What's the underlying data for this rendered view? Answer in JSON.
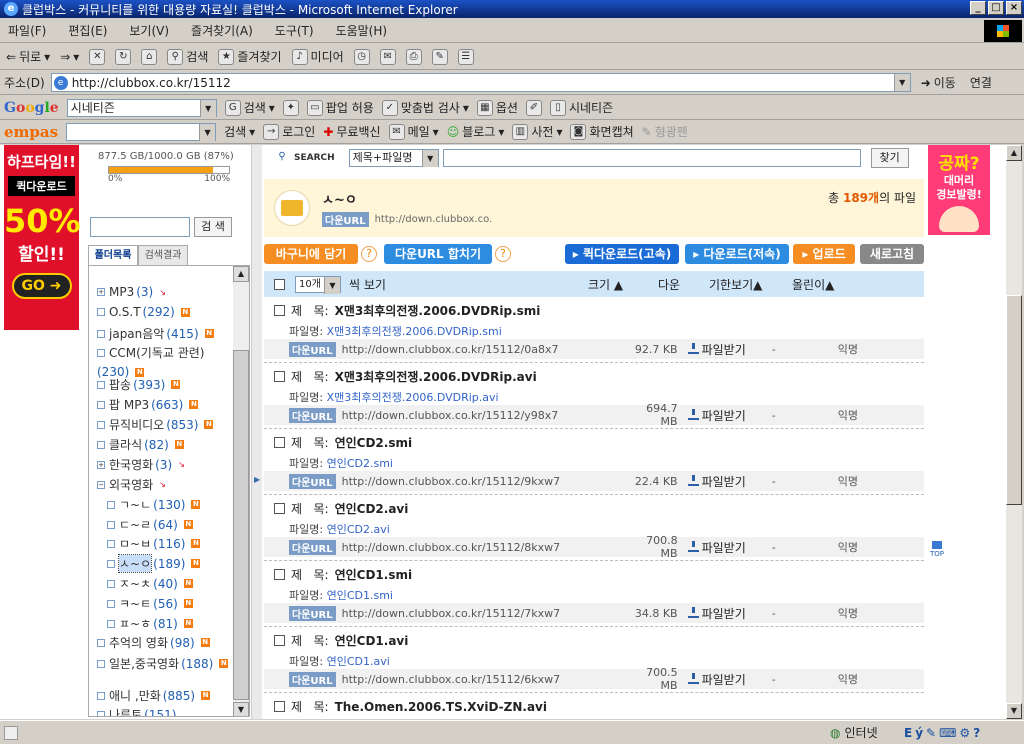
{
  "window": {
    "title": "클럽박스 - 커뮤니티를 위한 대용량 자료실! 클럽박스 - Microsoft Internet Explorer"
  },
  "menu": [
    "파일(F)",
    "편집(E)",
    "보기(V)",
    "즐겨찾기(A)",
    "도구(T)",
    "도움말(H)"
  ],
  "toolbar": {
    "back": "뒤로",
    "search": "검색",
    "favorites": "즐겨찾기",
    "media": "미디어"
  },
  "address": {
    "label": "주소(D)",
    "url": "http://clubbox.co.kr/15112",
    "go": "이동",
    "links": "연결"
  },
  "google_bar": {
    "logo": "Google",
    "query": "시네티즌",
    "search": "검색",
    "popup": "팝업 허용",
    "spell": "맞춤법 검사",
    "options": "옵션",
    "highlight": "시네티즌"
  },
  "empas_bar": {
    "logo": "empas",
    "search": "검색",
    "login": "로그인",
    "vaccine": "무료백신",
    "mail": "메일",
    "blog": "블로그",
    "dict": "사전",
    "capture": "화면캡쳐",
    "pen": "형광펜"
  },
  "status": {
    "zone": "인터넷"
  },
  "ads": {
    "left": {
      "line1": "하프타임!!",
      "line2": "퀵다운로드",
      "line3": "50%",
      "line4": "할인!!",
      "go": "GO"
    },
    "right": {
      "line1": "공짜?",
      "line2": "대머리",
      "line3": "경보발령!"
    }
  },
  "sidebar": {
    "quota": "877.5 GB/1000.0 GB (87%)",
    "quota_percent": 87,
    "quota_min": "0%",
    "quota_max": "100%",
    "search_btn": "검 색",
    "tab_folders": "폴더목록",
    "tab_results": "검색결과",
    "folders": [
      {
        "label": "MP3",
        "count": "(3)",
        "mark": "hot",
        "expand": "+",
        "sub": false,
        "sel": false
      },
      {
        "label": "O.S.T",
        "count": "(292)",
        "mark": "N",
        "expand": "",
        "sub": false,
        "sel": false
      },
      {
        "label": "japan음악",
        "count": "(415)",
        "mark": "N",
        "expand": "",
        "sub": false,
        "sel": false
      },
      {
        "label": "CCM(기독교 관련)",
        "count": "(230)",
        "mark": "N",
        "expand": "",
        "sub": false,
        "sel": false
      },
      {
        "label": "팝송",
        "count": "(393)",
        "mark": "N",
        "expand": "",
        "sub": false,
        "sel": false
      },
      {
        "label": "팝 MP3",
        "count": "(663)",
        "mark": "N",
        "expand": "",
        "sub": false,
        "sel": false
      },
      {
        "label": "뮤직비디오",
        "count": "(853)",
        "mark": "N",
        "expand": "",
        "sub": false,
        "sel": false
      },
      {
        "label": "클라식",
        "count": "(82)",
        "mark": "N",
        "expand": "",
        "sub": false,
        "sel": false
      },
      {
        "label": "한국영화",
        "count": "(3)",
        "mark": "hot",
        "expand": "+",
        "sub": false,
        "sel": false
      },
      {
        "label": "외국영화",
        "count": "",
        "mark": "hot",
        "expand": "−",
        "sub": false,
        "sel": false
      },
      {
        "label": "ㄱ~ㄴ",
        "count": "(130)",
        "mark": "N",
        "expand": "",
        "sub": true,
        "sel": false
      },
      {
        "label": "ㄷ~ㄹ",
        "count": "(64)",
        "mark": "N",
        "expand": "",
        "sub": true,
        "sel": false
      },
      {
        "label": "ㅁ~ㅂ",
        "count": "(116)",
        "mark": "N",
        "expand": "",
        "sub": true,
        "sel": false
      },
      {
        "label": "ㅅ~ㅇ",
        "count": "(189)",
        "mark": "N",
        "expand": "",
        "sub": true,
        "sel": true
      },
      {
        "label": "ㅈ~ㅊ",
        "count": "(40)",
        "mark": "N",
        "expand": "",
        "sub": true,
        "sel": false
      },
      {
        "label": "ㅋ~ㅌ",
        "count": "(56)",
        "mark": "N",
        "expand": "",
        "sub": true,
        "sel": false
      },
      {
        "label": "ㅍ~ㅎ",
        "count": "(81)",
        "mark": "N",
        "expand": "",
        "sub": true,
        "sel": false
      },
      {
        "label": "추억의 영화",
        "count": "(98)",
        "mark": "N",
        "expand": "",
        "sub": false,
        "sel": false
      },
      {
        "label": "일본,중국영화",
        "count": "(188)",
        "mark": "N",
        "expand": "",
        "sub": false,
        "sel": false
      },
      {
        "label": "애니 ,만화",
        "count": "(885)",
        "mark": "N",
        "expand": "",
        "sub": false,
        "sel": false
      },
      {
        "label": "나루토",
        "count": "(151)",
        "mark": "",
        "expand": "",
        "sub": false,
        "sel": false
      }
    ]
  },
  "search": {
    "label": "SEARCH",
    "scope": "제목+파일명",
    "button": "찾기"
  },
  "folder": {
    "name": "ㅅ~ㅇ",
    "url_tag": "다운URL",
    "url": "http://down.clubbox.co.",
    "total_prefix": "총",
    "total_count": "189개",
    "total_suffix": "의 파일"
  },
  "actions": {
    "basket": "바구니에 담기",
    "merge": "다운URL 합치기",
    "quick": "퀵다운로드(고속)",
    "download": "다운로드(저속)",
    "upload": "업로드",
    "refresh": "새로고침"
  },
  "table": {
    "per_page": "10개",
    "per_page_suffix": "씩 보기",
    "size": "크기",
    "down": "다운",
    "expire": "기한보기",
    "uploader": "올린이"
  },
  "files": [
    {
      "title_label": "제   목:",
      "title": "X맨3최후의전쟁.2006.DVDRip.smi",
      "fname_label": "파일명:",
      "fname": "X맨3최후의전쟁.2006.DVDRip.smi",
      "url_tag": "다운URL",
      "url": "http://down.clubbox.co.kr/15112/0a8x7",
      "size": "92.7 KB",
      "dl": "파일받기",
      "expire": "-",
      "uploader": "익명"
    },
    {
      "title_label": "제   목:",
      "title": "X맨3최후의전쟁.2006.DVDRip.avi",
      "fname_label": "파일명:",
      "fname": "X맨3최후의전쟁.2006.DVDRip.avi",
      "url_tag": "다운URL",
      "url": "http://down.clubbox.co.kr/15112/y98x7",
      "size": "694.7 MB",
      "dl": "파일받기",
      "expire": "-",
      "uploader": "익명"
    },
    {
      "title_label": "제   목:",
      "title": "연인CD2.smi",
      "fname_label": "파일명:",
      "fname": "연인CD2.smi",
      "url_tag": "다운URL",
      "url": "http://down.clubbox.co.kr/15112/9kxw7",
      "size": "22.4 KB",
      "dl": "파일받기",
      "expire": "-",
      "uploader": "익명"
    },
    {
      "title_label": "제   목:",
      "title": "연인CD2.avi",
      "fname_label": "파일명:",
      "fname": "연인CD2.avi",
      "url_tag": "다운URL",
      "url": "http://down.clubbox.co.kr/15112/8kxw7",
      "size": "700.8 MB",
      "dl": "파일받기",
      "expire": "-",
      "uploader": "익명"
    },
    {
      "title_label": "제   목:",
      "title": "연인CD1.smi",
      "fname_label": "파일명:",
      "fname": "연인CD1.smi",
      "url_tag": "다운URL",
      "url": "http://down.clubbox.co.kr/15112/7kxw7",
      "size": "34.8 KB",
      "dl": "파일받기",
      "expire": "-",
      "uploader": "익명"
    },
    {
      "title_label": "제   목:",
      "title": "연인CD1.avi",
      "fname_label": "파일명:",
      "fname": "연인CD1.avi",
      "url_tag": "다운URL",
      "url": "http://down.clubbox.co.kr/15112/6kxw7",
      "size": "700.5 MB",
      "dl": "파일받기",
      "expire": "-",
      "uploader": "익명"
    },
    {
      "title_label": "제   목:",
      "title": "The.Omen.2006.TS.XviD-ZN.avi"
    }
  ],
  "top_label": "TOP"
}
